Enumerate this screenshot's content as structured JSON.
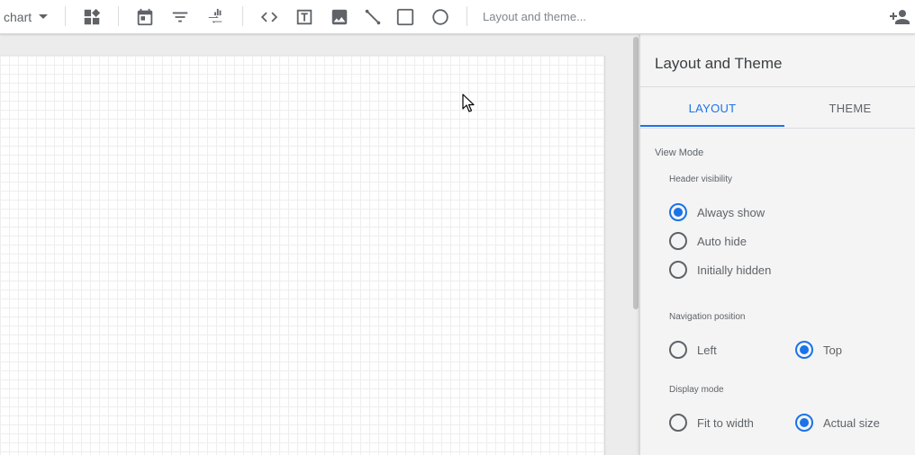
{
  "toolbar": {
    "chart_label": "chart",
    "layout_theme_link": "Layout and theme...",
    "icons": [
      "add-component-icon",
      "date-range-icon",
      "filter-icon",
      "data-control-icon",
      "url-embed-icon",
      "text-icon",
      "image-icon",
      "line-icon",
      "rectangle-icon",
      "circle-icon",
      "add-person-icon"
    ]
  },
  "panel": {
    "title": "Layout and Theme",
    "tabs": {
      "layout": "LAYOUT",
      "theme": "THEME",
      "active": "LAYOUT"
    },
    "view_mode": {
      "label": "View Mode",
      "header_visibility": {
        "label": "Header visibility",
        "options": [
          "Always show",
          "Auto hide",
          "Initially hidden"
        ],
        "selected": "Always show"
      },
      "navigation_position": {
        "label": "Navigation position",
        "options": [
          "Left",
          "Top"
        ],
        "selected": "Top"
      },
      "display_mode": {
        "label": "Display mode",
        "options": [
          "Fit to width",
          "Actual size"
        ],
        "selected": "Actual size"
      }
    }
  },
  "colors": {
    "accent": "#1a73e8",
    "icon": "#5f6368",
    "panel_bg": "#f4f4f4"
  }
}
